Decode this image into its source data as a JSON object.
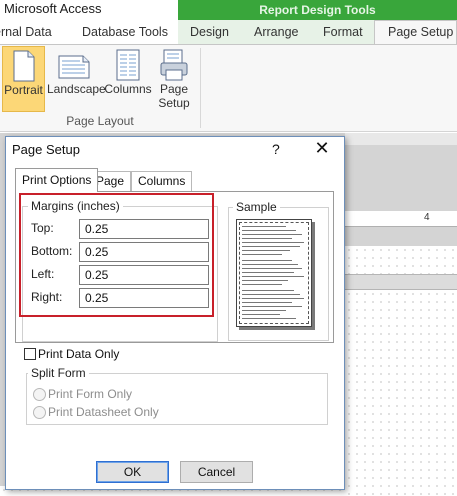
{
  "app": {
    "title": "Microsoft Access",
    "contextual_tab_group": "Report Design Tools"
  },
  "tabs": {
    "external_data": "ernal Data",
    "database_tools": "Database Tools",
    "design": "Design",
    "arrange": "Arrange",
    "format": "Format",
    "page_setup": "Page Setup",
    "active": "Page Setup"
  },
  "ribbon": {
    "group_label": "Page Layout",
    "buttons": {
      "portrait": "Portrait",
      "landscape": "Landscape",
      "columns": "Columns",
      "page_setup_line1": "Page",
      "page_setup_line2": "Setup"
    },
    "selected": "Portrait"
  },
  "ruler": {
    "mark": "4"
  },
  "dialog": {
    "title": "Page Setup",
    "help": "?",
    "close": "✕",
    "tabs": {
      "print_options": "Print Options",
      "page": "Page",
      "columns": "Columns",
      "active": "Print Options"
    },
    "margins": {
      "title": "Margins (inches)",
      "top_label": "Top:",
      "top_value": "0.25",
      "bottom_label": "Bottom:",
      "bottom_value": "0.25",
      "left_label": "Left:",
      "left_value": "0.25",
      "right_label": "Right:",
      "right_value": "0.25"
    },
    "sample": {
      "title": "Sample"
    },
    "print_data_only": {
      "label": "Print Data Only",
      "checked": false
    },
    "split_form": {
      "title": "Split Form",
      "option_form": "Print Form Only",
      "option_datasheet": "Print Datasheet Only",
      "enabled": false
    },
    "buttons": {
      "ok": "OK",
      "cancel": "Cancel"
    }
  },
  "colors": {
    "contextual_green": "#39a63b",
    "selected_button": "#fcd777",
    "highlight_red": "#c8202a",
    "ok_border": "#2f6fd1"
  }
}
